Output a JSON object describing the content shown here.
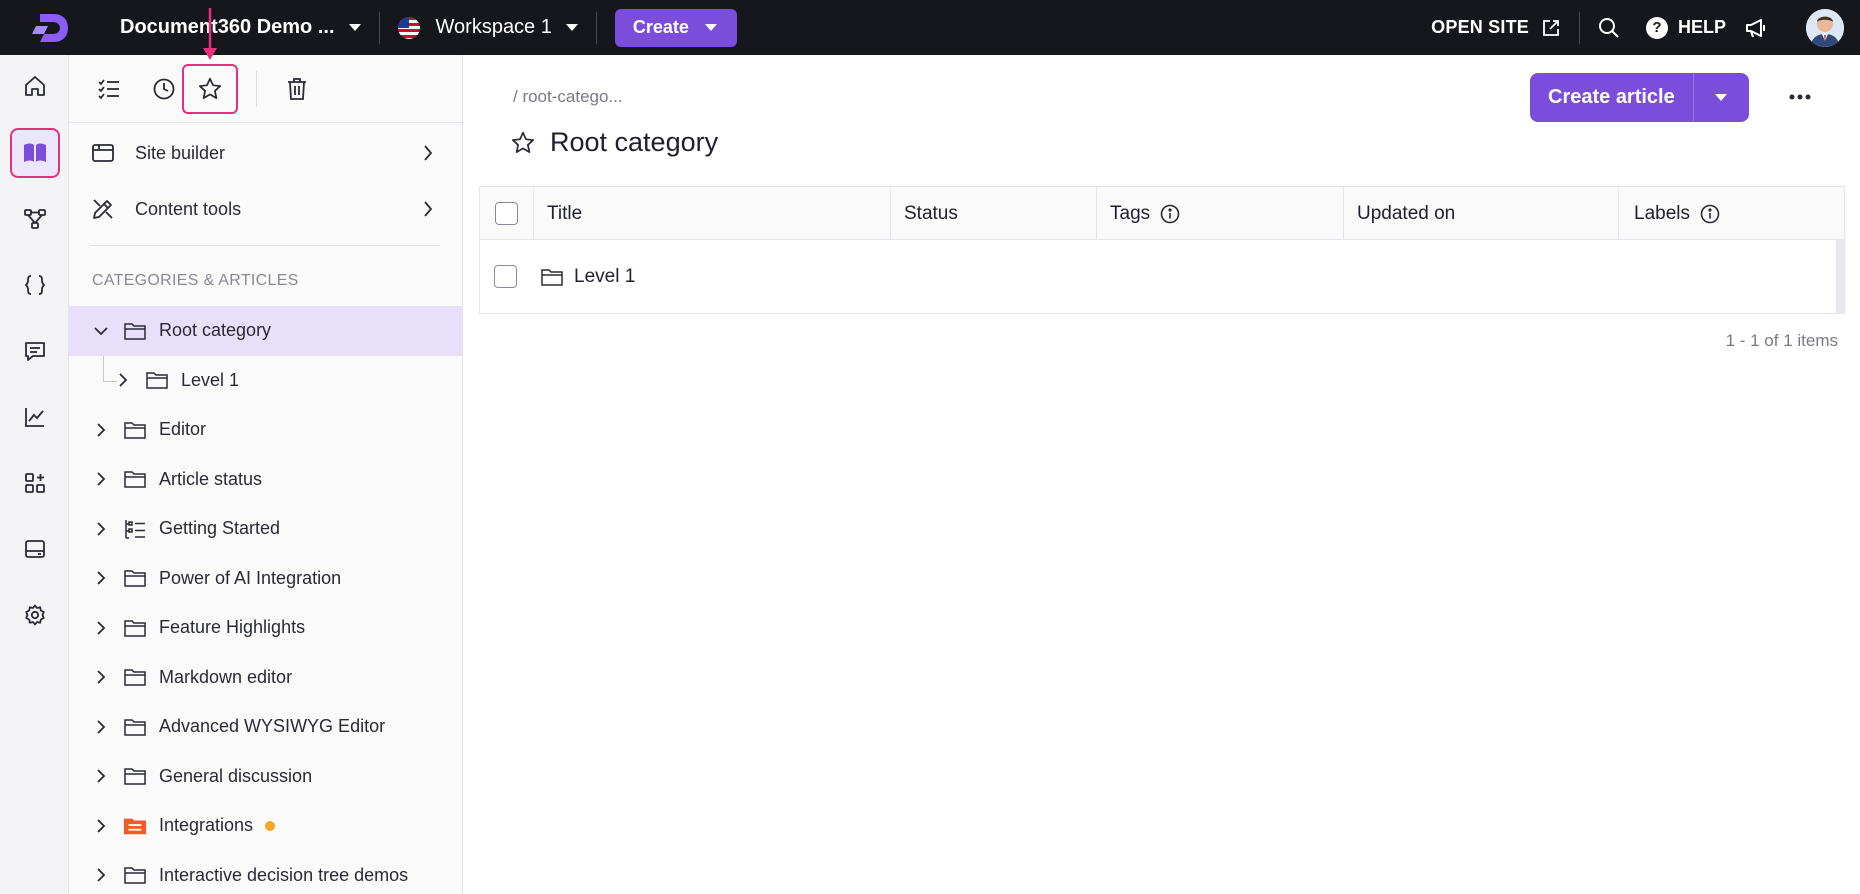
{
  "topbar": {
    "project_name": "Document360 Demo ...",
    "workspace": "Workspace 1",
    "create_label": "Create",
    "open_site_label": "OPEN SITE",
    "help_label": "HELP",
    "help_glyph": "?"
  },
  "rail": {
    "items": [
      {
        "name": "home-icon"
      },
      {
        "name": "documentation-icon",
        "active": true
      },
      {
        "name": "workflow-icon"
      },
      {
        "name": "api-icon"
      },
      {
        "name": "feedback-icon"
      },
      {
        "name": "analytics-icon"
      },
      {
        "name": "integrations-icon"
      },
      {
        "name": "widgets-icon"
      },
      {
        "name": "settings-icon"
      }
    ]
  },
  "sidebar": {
    "toolbar": [
      {
        "name": "all-articles-icon"
      },
      {
        "name": "recent-icon"
      },
      {
        "name": "star-icon",
        "highlighted": true
      },
      {
        "name": "trash-icon"
      }
    ],
    "menu": [
      {
        "label": "Site builder"
      },
      {
        "label": "Content tools"
      }
    ],
    "section_label": "CATEGORIES & ARTICLES",
    "tree": [
      {
        "label": "Root category",
        "expanded": true,
        "selected": true
      },
      {
        "label": "Level 1",
        "child": true
      },
      {
        "label": "Editor"
      },
      {
        "label": "Article status"
      },
      {
        "label": "Getting Started",
        "icon": "list-folder-icon"
      },
      {
        "label": "Power of AI Integration"
      },
      {
        "label": "Feature Highlights"
      },
      {
        "label": "Markdown editor"
      },
      {
        "label": "Advanced WYSIWYG Editor"
      },
      {
        "label": "General discussion"
      },
      {
        "label": "Integrations",
        "icon": "page-folder-icon",
        "badge": "dot"
      },
      {
        "label": "Interactive decision tree demos"
      }
    ]
  },
  "main": {
    "breadcrumb": "/ root-catego...",
    "title": "Root category",
    "create_article_label": "Create article",
    "columns": [
      "Title",
      "Status",
      "Tags",
      "Updated on",
      "Labels"
    ],
    "rows": [
      {
        "title": "Level 1"
      }
    ],
    "pager": "1 - 1 of 1 items"
  },
  "colors": {
    "accent": "#7c4ddb",
    "highlight": "#e8307a",
    "topbar": "#16161d",
    "selected_row": "#e8e0fb",
    "badge_dot": "#f5a623",
    "integrations_folder": "#f25a2b"
  }
}
